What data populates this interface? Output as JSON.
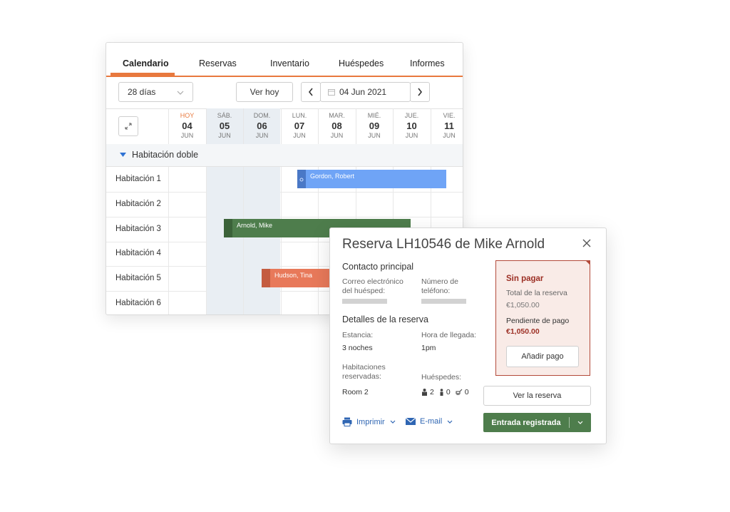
{
  "tabs": [
    "Calendario",
    "Reservas",
    "Inventario",
    "Huéspedes",
    "Informes"
  ],
  "toolbar": {
    "range_select": "28 días",
    "today_button": "Ver hoy",
    "date": "04 Jun 2021"
  },
  "days": [
    {
      "name": "HOY",
      "day": "04",
      "month": "JUN"
    },
    {
      "name": "SÁB.",
      "day": "05",
      "month": "JUN"
    },
    {
      "name": "DOM.",
      "day": "06",
      "month": "JUN"
    },
    {
      "name": "LUN.",
      "day": "07",
      "month": "JUN"
    },
    {
      "name": "MAR.",
      "day": "08",
      "month": "JUN"
    },
    {
      "name": "MIÉ.",
      "day": "09",
      "month": "JUN"
    },
    {
      "name": "JUE.",
      "day": "10",
      "month": "JUN"
    },
    {
      "name": "VIE.",
      "day": "11",
      "month": "JUN"
    }
  ],
  "group": "Habitación doble",
  "rooms": [
    "Habitación 1",
    "Habitación 2",
    "Habitación 3",
    "Habitación 4",
    "Habitación 5",
    "Habitación 6"
  ],
  "bookings": [
    "Gordon, Robert",
    "Arnold, Mike",
    "Hudson, Tina"
  ],
  "colors": {
    "accent": "#e8793e",
    "blue": "#6fa4f6",
    "green": "#4e7d4c",
    "orange": "#e8795a",
    "unpaid": "#b34a3a"
  },
  "popup": {
    "title": "Reserva LH10546 de Mike Arnold",
    "contact_title": "Contacto principal",
    "email_label": "Correo electrónico del huésped:",
    "phone_label": "Número de teléfono:",
    "details_title": "Detalles de la reserva",
    "stay_label": "Estancia:",
    "stay_value": "3 noches",
    "arrival_label": "Hora de llegada:",
    "arrival_value": "1pm",
    "rooms_label": "Habitaciones reservadas:",
    "rooms_value": "Room 2",
    "guests_label": "Huéspedes:",
    "guests_adults": "2",
    "guests_children": "0",
    "guests_infants": "0",
    "status": "Sin pagar",
    "total_label": "Total de la reserva",
    "total_value": "€1,050.00",
    "pending_label": "Pendiente de pago",
    "pending_value": "€1,050.00",
    "add_payment": "Añadir pago",
    "view_booking": "Ver la reserva",
    "print": "Imprimir",
    "email": "E-mail",
    "checkin": "Entrada registrada"
  }
}
